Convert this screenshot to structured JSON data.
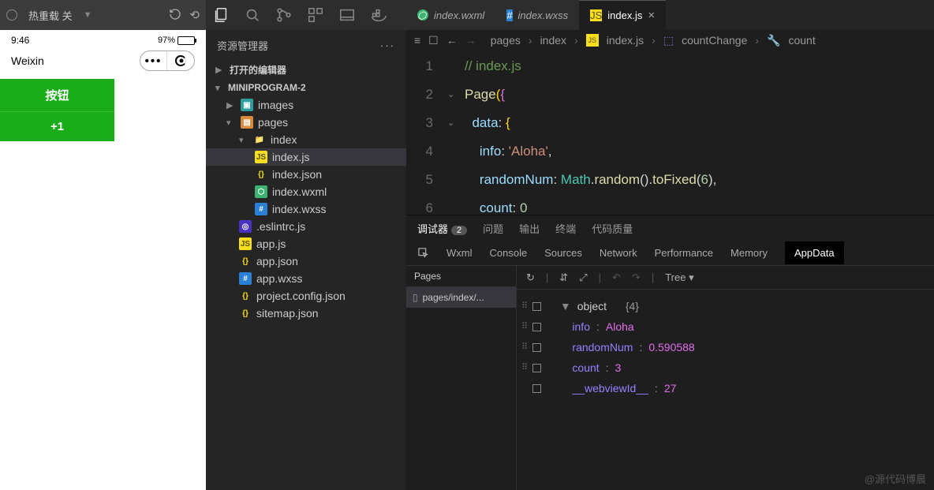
{
  "simulator": {
    "hot_reload": "热重载 关",
    "status_time": "9:46",
    "battery_pct": "97%",
    "app_title": "Weixin",
    "button_label": "按钮",
    "plus_label": "+1"
  },
  "explorer": {
    "title": "资源管理器",
    "open_editors": "打开的编辑器",
    "project": "MINIPROGRAM-2",
    "tree": {
      "images": "images",
      "pages": "pages",
      "index_folder": "index",
      "index_js": "index.js",
      "index_json": "index.json",
      "index_wxml": "index.wxml",
      "index_wxss": "index.wxss",
      "eslintrc": ".eslintrc.js",
      "app_js": "app.js",
      "app_json": "app.json",
      "app_wxss": "app.wxss",
      "project_config": "project.config.json",
      "sitemap": "sitemap.json"
    }
  },
  "tabs": {
    "wxml": "index.wxml",
    "wxss": "index.wxss",
    "js": "index.js"
  },
  "breadcrumb": {
    "pages": "pages",
    "index": "index",
    "file": "index.js",
    "fn": "countChange",
    "var": "count"
  },
  "code": {
    "l1": "// index.js",
    "l2a": "Page",
    "l2b": "(",
    "l2c": "{",
    "l3a": "data",
    "l3b": ":",
    "l3c": " {",
    "l4a": "info",
    "l4b": ": ",
    "l4c": "'Aloha'",
    "l4d": ",",
    "l5a": "randomNum",
    "l5b": ": ",
    "l5c": "Math",
    "l5d": ".",
    "l5e": "random",
    "l5f": "().",
    "l5g": "toFixed",
    "l5h": "(",
    "l5i": "6",
    "l5j": "),",
    "l6a": "count",
    "l6b": ": ",
    "l6c": "0"
  },
  "debug": {
    "tab1": "调试器",
    "badge": "2",
    "tab2": "问题",
    "tab3": "输出",
    "tab4": "终端",
    "tab5": "代码质量",
    "t_wxml": "Wxml",
    "t_console": "Console",
    "t_sources": "Sources",
    "t_network": "Network",
    "t_perf": "Performance",
    "t_mem": "Memory",
    "t_appdata": "AppData",
    "pages_hd": "Pages",
    "page_item": "pages/index/...",
    "tree_mode": "Tree",
    "obj_header_a": "object",
    "obj_header_b": "{4}",
    "info_k": "info",
    "info_v": "Aloha",
    "rand_k": "randomNum",
    "rand_v": "0.590588",
    "count_k": "count",
    "count_v": "3",
    "wv_k": "__webviewId__",
    "wv_v": "27"
  },
  "watermark": "@源代码博晨"
}
